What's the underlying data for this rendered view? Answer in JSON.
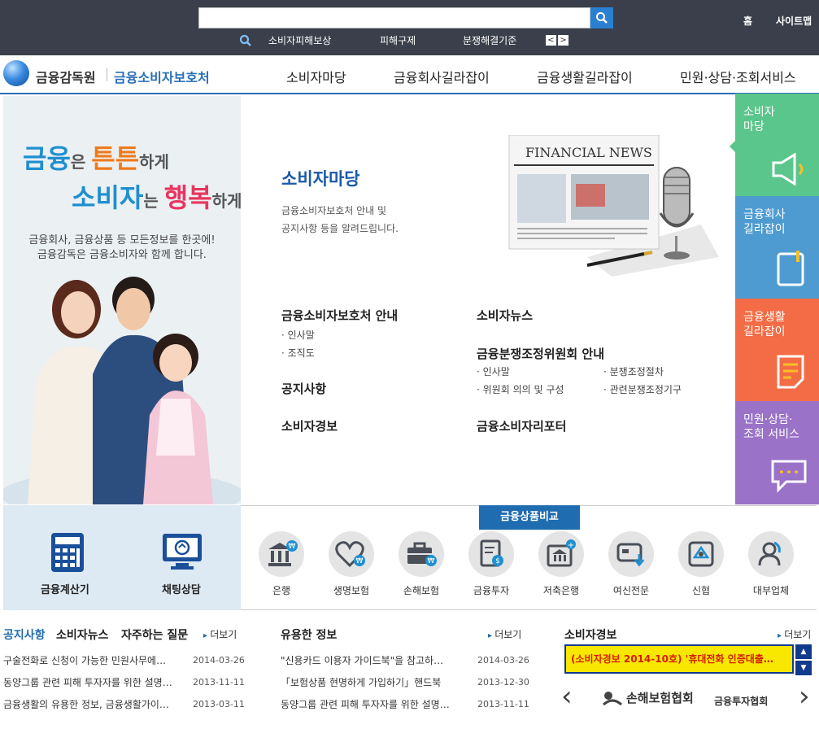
{
  "topbar": {
    "search_placeholder": "",
    "keywords": [
      "소비자피해보상",
      "피해구제",
      "분쟁해결기준"
    ],
    "prev_label": "<",
    "next_label": ">",
    "home_label": "홈",
    "sitemap_label": "사이트맵"
  },
  "header": {
    "logo_primary": "금융감독원",
    "logo_secondary": "금융소비자보호처",
    "nav": [
      "소비자마당",
      "금융회사길라잡이",
      "금융생활길라잡이",
      "민원·상담·조회서비스"
    ]
  },
  "promo": {
    "slogan_line1_a": "금융",
    "slogan_line1_b": "은 ",
    "slogan_line1_c": "튼튼",
    "slogan_line1_d": "하게",
    "slogan_line2_a": "소비자",
    "slogan_line2_b": "는 ",
    "slogan_line2_c": "행복",
    "slogan_line2_d": "하게",
    "desc_line1": "금융회사, 금융상품 등 모든정보를 한곳에!",
    "desc_line2": "금융감독은 금융소비자와 함께 합니다."
  },
  "main": {
    "title": "소비자마당",
    "desc_line1": "금융소비자보호처 안내 및",
    "desc_line2": "공지사항 등을 알려드립니다.",
    "newspaper_title": "FINANCIAL NEWS",
    "sections": {
      "guide_title": "금융소비자보호처 안내",
      "guide_items": [
        "인사말",
        "조직도"
      ],
      "notice_title": "공지사항",
      "alert_title": "소비자경보",
      "news_title": "소비자뉴스",
      "dispute_title": "금융분쟁조정위원회 안내",
      "dispute_items": [
        "인사말",
        "분쟁조정절차",
        "위원회 의의 및 구성",
        "관련분쟁조정기구"
      ],
      "reporter_title": "금융소비자리포터"
    }
  },
  "right_tabs": [
    {
      "label": "소비자\n마당",
      "color": "#5bc68b"
    },
    {
      "label": "금융회사\n길라잡이",
      "color": "#4e9bd1"
    },
    {
      "label": "금융생활\n길라잡이",
      "color": "#f36c45"
    },
    {
      "label": "민원·상담·\n조회 서비스",
      "color": "#9a72c8"
    }
  ],
  "quick": {
    "calculator_label": "금융계산기",
    "chat_label": "채팅상담"
  },
  "products": {
    "tab_label": "금융상품비교",
    "items": [
      "은행",
      "생명보험",
      "손해보험",
      "금융투자",
      "저축은행",
      "여신전문",
      "신협",
      "대부업체"
    ]
  },
  "bottom": {
    "left_tabs": [
      "공지사항",
      "소비자뉴스",
      "자주하는 질문"
    ],
    "more_label": "더보기",
    "notices": [
      {
        "title": "구술전화로 신청이 가능한 민원사무에…",
        "date": "2014-03-26"
      },
      {
        "title": "동양그룹 관련 피해 투자자를 위한 설명…",
        "date": "2013-11-11"
      },
      {
        "title": "금융생활의 유용한 정보, 금융생활가이…",
        "date": "2013-03-11"
      }
    ],
    "useful_title": "유용한 정보",
    "useful": [
      {
        "title": "\"신용카드 이용자 가이드북\"을 참고하…",
        "date": "2014-03-26"
      },
      {
        "title": "「보험상품 현명하게 가입하기」핸드북",
        "date": "2013-12-30"
      },
      {
        "title": "동양그룹 관련 피해 투자자를 위한 설명…",
        "date": "2013-11-11"
      }
    ],
    "alert_title": "소비자경보",
    "alert_text": "(소비자경보 2014-10호) '휴대전화 인증대출…",
    "partners": [
      "손해보험협회",
      "금융투자협회"
    ]
  }
}
